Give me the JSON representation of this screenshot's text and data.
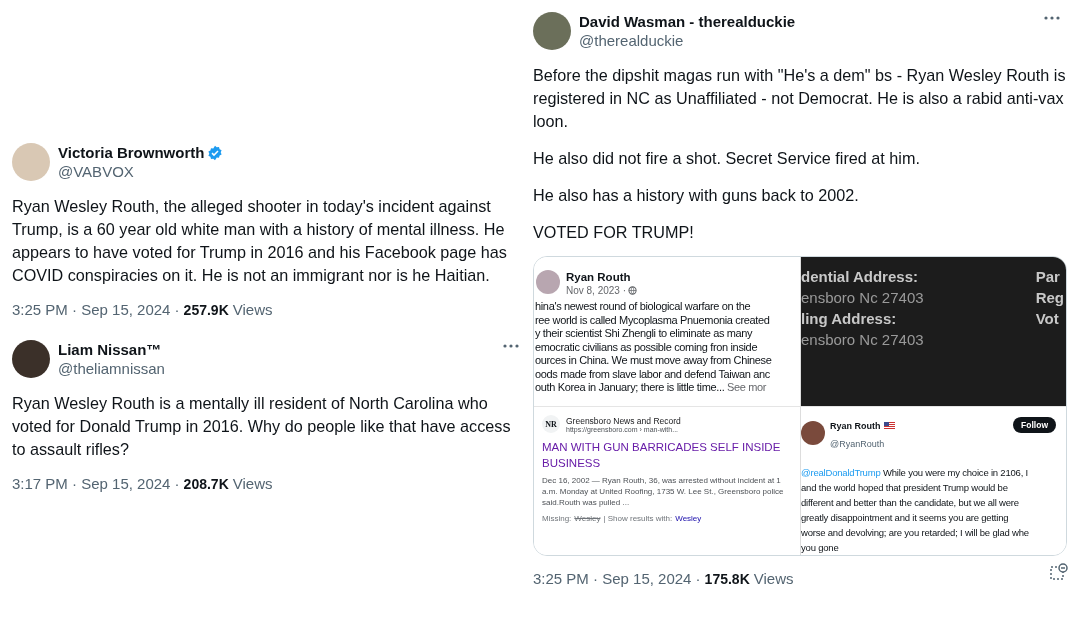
{
  "left_tweets": [
    {
      "name": "Victoria Brownworth",
      "verified": true,
      "menu": false,
      "handle": "@VABVOX",
      "text": "Ryan Wesley Routh, the alleged shooter in today's incident against Trump, is a 60 year old white man with a history of mental illness. He appears to have voted for Trump in 2016 and his Facebook page has COVID conspiracies on it. He is not an immigrant nor is he Haitian.",
      "meta": "3:25 PM · Sep 15, 2024 ·",
      "views": "257.9K",
      "views_label": "Views"
    },
    {
      "name": "Liam Nissan™",
      "verified": false,
      "menu": true,
      "handle": "@theliamnissan",
      "text": "Ryan Wesley Routh is a mentally ill resident of North Carolina who voted for Donald Trump in 2016. Why do people like that have access to assault rifles?",
      "meta": "3:17 PM · Sep 15, 2024 ·",
      "views": "208.7K",
      "views_label": "Views"
    }
  ],
  "right_tweet": {
    "name": "David Wasman - therealduckie",
    "verified": false,
    "menu": true,
    "handle": "@therealduckie",
    "paragraphs": [
      "Before the dipshit magas run with \"He's a dem\" bs - Ryan Wesley Routh is registered in NC as Unaffiliated - not Democrat. He is also a rabid anti-vax loon.",
      "He also did not fire a shot. Secret Service fired at him.",
      "He also has a history with guns back to 2002.",
      "VOTED FOR TRUMP!"
    ],
    "media": {
      "fb_post": {
        "name": "Ryan Routh",
        "date": "Nov 8, 2023 ·",
        "lines": [
          "hina's newest round of biological warfare on the",
          "ree world is called Mycoplasma Pnuemonia created",
          "y their scientist Shi Zhengli to eliminate as many",
          "emocratic civilians as possible coming fron inside",
          "ources in China. We must move away from Chinese",
          "oods made from slave labor and defend Taiwan anc",
          "outh Korea in January; there is little time..."
        ],
        "see_more": "See mor"
      },
      "news_result": {
        "logo": "NR",
        "source": "Greensboro News and Record",
        "url": "https://greensboro.com › man-with...",
        "headline": "MAN WITH GUN BARRICADES SELF INSIDE BUSINESS",
        "snippet": "Dec 16, 2002 — Ryan Routh, 36, was arrested without incident at 1 a.m. Monday at United Roofing, 1735 W. Lee St., Greensboro police said.Routh was pulled ...",
        "missing_label": "Missing:",
        "missing_word": "Wesley",
        "show_label": "| Show results with:",
        "show_word": "Wesley"
      },
      "voter_panel": {
        "left_lines": [
          {
            "text": "dential Address:",
            "kind": "label"
          },
          {
            "text": "ensboro Nc 27403",
            "kind": "value"
          },
          {
            "text": "ling Address:",
            "kind": "label"
          },
          {
            "text": "ensboro Nc 27403",
            "kind": "value"
          }
        ],
        "right_lines": [
          "Par",
          "Reg",
          "Vot"
        ]
      },
      "embedded_tweet": {
        "name": "Ryan Routh",
        "handle": "@RyanRouth",
        "follow": "Follow",
        "mention": "@realDonaldTrump",
        "lines": [
          "While you were my choice in 2106, I",
          "and the world hoped that president Trump would be",
          "different and better than the candidate, but we all were",
          "greatly disappointment and it seems you are getting",
          "worse and devolving; are you retarded; I will be glad whe",
          "you gone"
        ]
      }
    },
    "meta": "3:25 PM · Sep 15, 2024 ·",
    "views": "175.8K",
    "views_label": "Views"
  }
}
